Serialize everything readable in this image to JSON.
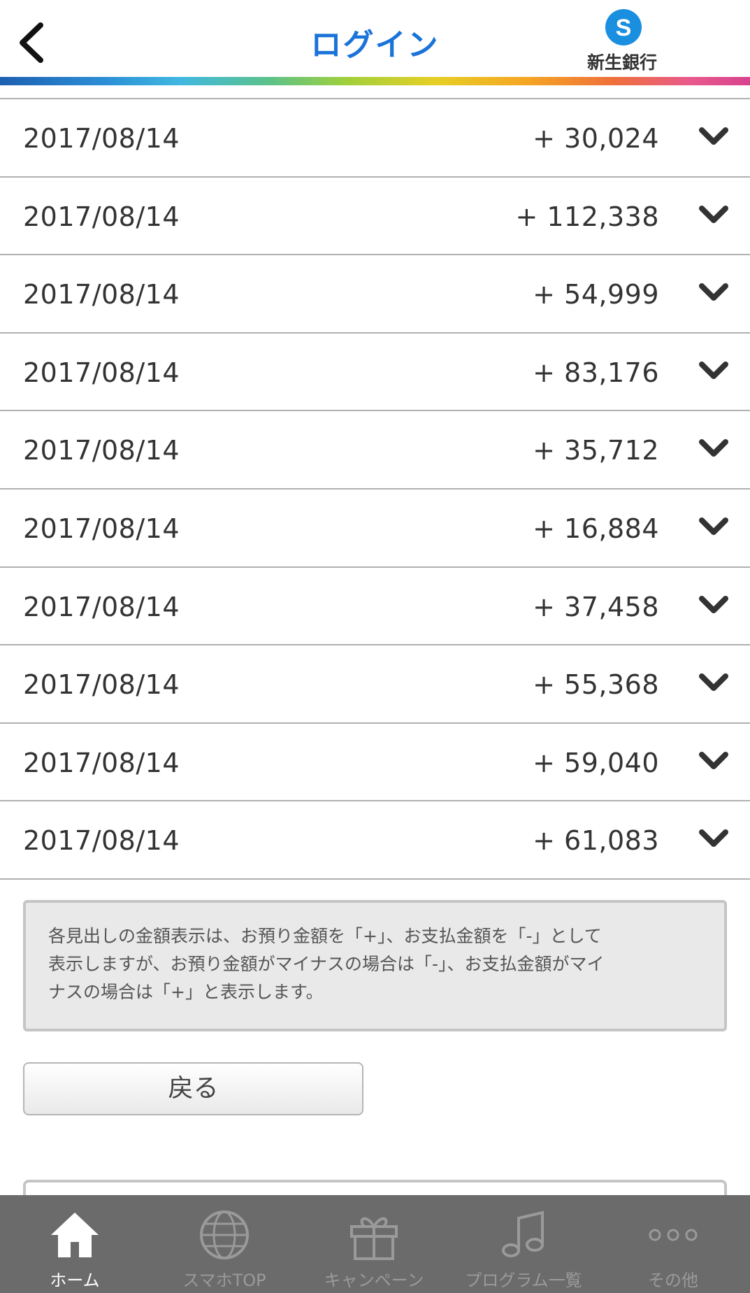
{
  "header": {
    "title": "ログイン",
    "logo_text": "新生銀行",
    "logo_letter": "S"
  },
  "transactions": [
    {
      "date": "2017/08/14",
      "amount": "+ 30,024"
    },
    {
      "date": "2017/08/14",
      "amount": "+ 112,338"
    },
    {
      "date": "2017/08/14",
      "amount": "+ 54,999"
    },
    {
      "date": "2017/08/14",
      "amount": "+ 83,176"
    },
    {
      "date": "2017/08/14",
      "amount": "+ 35,712"
    },
    {
      "date": "2017/08/14",
      "amount": "+ 16,884"
    },
    {
      "date": "2017/08/14",
      "amount": "+ 37,458"
    },
    {
      "date": "2017/08/14",
      "amount": "+ 55,368"
    },
    {
      "date": "2017/08/14",
      "amount": "+ 59,040"
    },
    {
      "date": "2017/08/14",
      "amount": "+ 61,083"
    }
  ],
  "note": {
    "line1": "各見出しの金額表示は、お預り金額を「+」、お支払金額を「-」として",
    "line2": "表示しますが、お預り金額がマイナスの場合は「-」、お支払金額がマイ",
    "line3": "ナスの場合は「+」と表示します。"
  },
  "back_button_label": "戻る",
  "tabbar": {
    "items": [
      {
        "label": "ホーム",
        "icon": "home-icon",
        "active": true
      },
      {
        "label": "スマホTOP",
        "icon": "globe-www-icon",
        "active": false
      },
      {
        "label": "キャンペーン",
        "icon": "gift-icon",
        "active": false
      },
      {
        "label": "プログラム一覧",
        "icon": "music-note-icon",
        "active": false
      },
      {
        "label": "その他",
        "icon": "more-dots-icon",
        "active": false
      }
    ]
  },
  "colors": {
    "title_blue": "#1a73d9",
    "logo_blue": "#1a8fe0",
    "tabbar_bg": "#6b6b6b",
    "tab_active": "#ffffff",
    "tab_inactive": "#9a9a9a"
  }
}
